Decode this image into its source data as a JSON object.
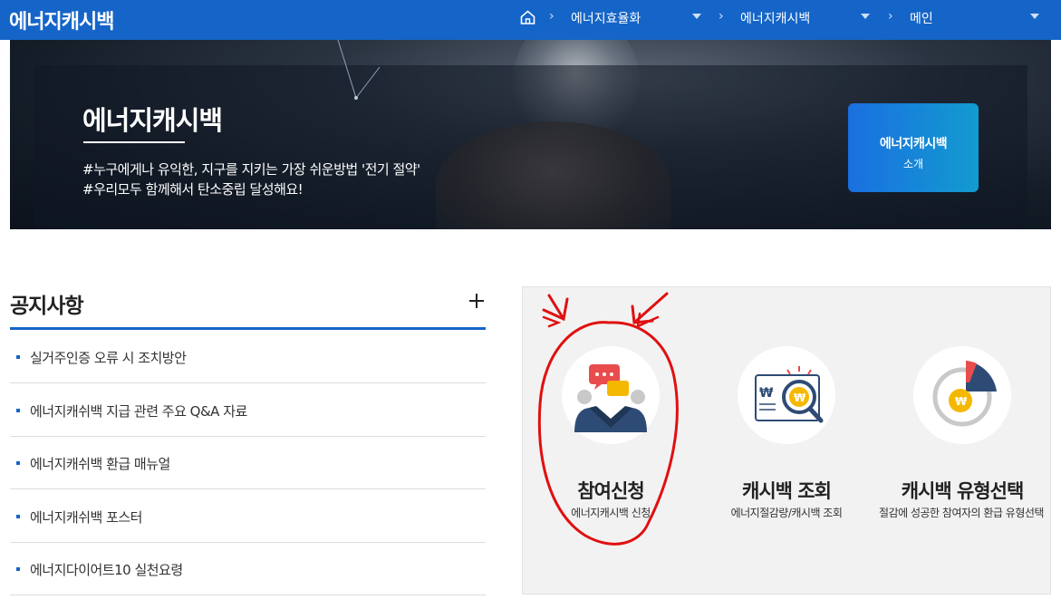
{
  "header": {
    "site_title": "에너지캐시백",
    "home_icon": "home-icon",
    "breadcrumbs": [
      {
        "label": "에너지효율화"
      },
      {
        "label": "에너지캐시백"
      },
      {
        "label": "메인"
      }
    ],
    "bar_color": "#1565c8"
  },
  "hero": {
    "title": "에너지캐시백",
    "desc_line1": "#누구에게나 유익한, 지구를 지키는 가장 쉬운방법 '전기 절약'",
    "desc_line2": "#우리모두 함께해서 탄소중립 달성해요!",
    "intro_button": {
      "line1": "에너지캐시백",
      "line2": "소개"
    }
  },
  "notice": {
    "title": "공지사항",
    "more_icon": "plus-icon",
    "items": [
      {
        "label": "실거주인증 오류 시 조치방안"
      },
      {
        "label": "에너지캐쉬백 지급 관련 주요 Q&A 자료"
      },
      {
        "label": "에너지캐쉬백 환급 매뉴얼"
      },
      {
        "label": "에너지캐쉬백 포스터"
      },
      {
        "label": "에너지다이어트10 실천요령"
      }
    ]
  },
  "services": [
    {
      "title": "참여신청",
      "subtitle": "에너지캐시백 신청",
      "icon": "participation-icon"
    },
    {
      "title": "캐시백 조회",
      "subtitle": "에너지절감량/캐시백 조회",
      "icon": "cashback-search-icon"
    },
    {
      "title": "캐시백 유형선택",
      "subtitle": "절감에 성공한 참여자의 환급 유형선택",
      "icon": "cashback-type-pie-icon"
    }
  ],
  "annotation": {
    "color": "#e01010",
    "shape": "hand-drawn circle with two arrows around 참여신청"
  }
}
